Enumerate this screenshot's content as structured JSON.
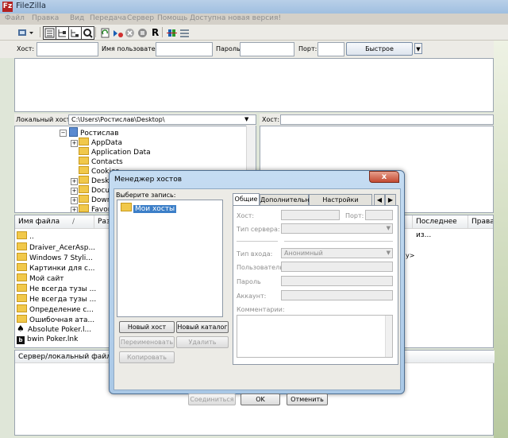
{
  "window": {
    "icon_text": "Fz",
    "title": "FileZilla"
  },
  "menu": [
    "Файл",
    "Правка",
    "Вид",
    "Передача",
    "Сервер",
    "Помощь",
    "Доступна новая версия!"
  ],
  "toolbar": {
    "icons": [
      "site-manager-icon",
      "toggle-log-icon",
      "toggle-local-tree-icon",
      "toggle-remote-tree-icon",
      "toggle-queue-icon",
      "refresh-icon",
      "process-queue-icon",
      "cancel-icon",
      "disconnect-icon",
      "reconnect-icon",
      "compare-icon",
      "sync-browse-icon"
    ],
    "reconnect_letter": "R"
  },
  "quickconnect": {
    "host_label": "Хост:",
    "user_label": "Имя пользователя",
    "pass_label": "Пароль",
    "port_label": "Порт:",
    "button_label": "Быстрое соединение",
    "dropdown_arrow": "▼"
  },
  "local": {
    "label": "Локальный хост:",
    "path": "C:\\Users\\Ростислав\\Desktop\\",
    "dropdown_arrow": "▼",
    "tree": [
      {
        "label": "Ростислав",
        "level": 0,
        "expander": "−",
        "icon": "user-folder-icon"
      },
      {
        "label": "AppData",
        "level": 1,
        "expander": "+"
      },
      {
        "label": "Application Data",
        "level": 1,
        "expander": ""
      },
      {
        "label": "Contacts",
        "level": 1,
        "expander": ""
      },
      {
        "label": "Cookies",
        "level": 1,
        "expander": ""
      },
      {
        "label": "Deskt",
        "level": 1,
        "expander": "+"
      },
      {
        "label": "Docu",
        "level": 1,
        "expander": "+"
      },
      {
        "label": "Downl",
        "level": 1,
        "expander": "+"
      },
      {
        "label": "Favori",
        "level": 1,
        "expander": "+"
      }
    ],
    "columns": [
      "Имя файла",
      "Раз"
    ],
    "sort_arrow": "/",
    "files": [
      {
        "name": "..",
        "icon": "folder"
      },
      {
        "name": "Draiver_AcerAsp...",
        "icon": "folder"
      },
      {
        "name": "Windows 7 Styli...",
        "icon": "folder"
      },
      {
        "name": "Картинки для с...",
        "icon": "folder"
      },
      {
        "name": "Мой сайт",
        "icon": "folder"
      },
      {
        "name": "Не всегда тузы ...",
        "icon": "folder"
      },
      {
        "name": "Не всегда тузы ...",
        "icon": "folder"
      },
      {
        "name": "Определение с...",
        "icon": "folder"
      },
      {
        "name": "Ошибочная ата...",
        "icon": "folder"
      },
      {
        "name": "Absolute Poker.l...",
        "icon": "spade"
      },
      {
        "name": "bwin Poker.lnk",
        "icon": "bwin"
      }
    ]
  },
  "remote": {
    "label": "Хост:",
    "columns": [
      "Последнее из...",
      "Права"
    ],
    "fragment": "у>"
  },
  "queue": {
    "header": "Сервер/локальный файл"
  },
  "dialog": {
    "title": "Менеджер хостов",
    "close_label": "x",
    "select_label": "Выберите запись:",
    "site_root": "Мои хосты",
    "buttons": {
      "new_site": "Новый хост",
      "new_folder": "Новый каталог",
      "rename": "Переименовать",
      "delete": "Удалить",
      "copy": "Копировать",
      "connect": "Соединиться",
      "ok": "OK",
      "cancel": "Отменить"
    },
    "tabs": [
      "Общие",
      "Дополнительно",
      "Настройки передачи"
    ],
    "tab_scroll": [
      "◀",
      "▶"
    ],
    "fields": {
      "host": "Хост:",
      "port": "Порт:",
      "server_type": "Тип сервера:",
      "logon_type": "Тип входа:",
      "logon_value": "Анонимный",
      "user": "Пользователь:",
      "password": "Пароль",
      "account": "Аккаунт:",
      "comments": "Комментарии:"
    },
    "combo_arrow": "▼"
  }
}
